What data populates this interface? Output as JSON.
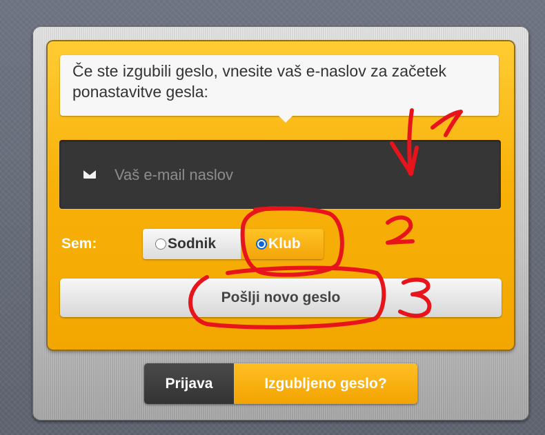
{
  "form": {
    "instruction": "Če ste izgubili geslo, vnesite vaš e-naslov za začetek ponastavitve gesla:",
    "email_placeholder": "Vaš e-mail naslov",
    "email_icon": "envelope-icon",
    "role_label": "Sem:",
    "roles": [
      {
        "label": "Sodnik",
        "checked": false
      },
      {
        "label": "Klub",
        "checked": true
      }
    ],
    "submit_label": "Pošlji novo geslo"
  },
  "tabs": [
    {
      "label": "Prijava",
      "active": false
    },
    {
      "label": "Izgubljeno geslo?",
      "active": true
    }
  ],
  "annotations": {
    "step1": "1",
    "step2": "2",
    "step3": "3",
    "color": "#e8141c"
  },
  "colors": {
    "accent": "#f8b10a",
    "dark_input": "#363636",
    "radio_selected": "#0a66d8"
  }
}
